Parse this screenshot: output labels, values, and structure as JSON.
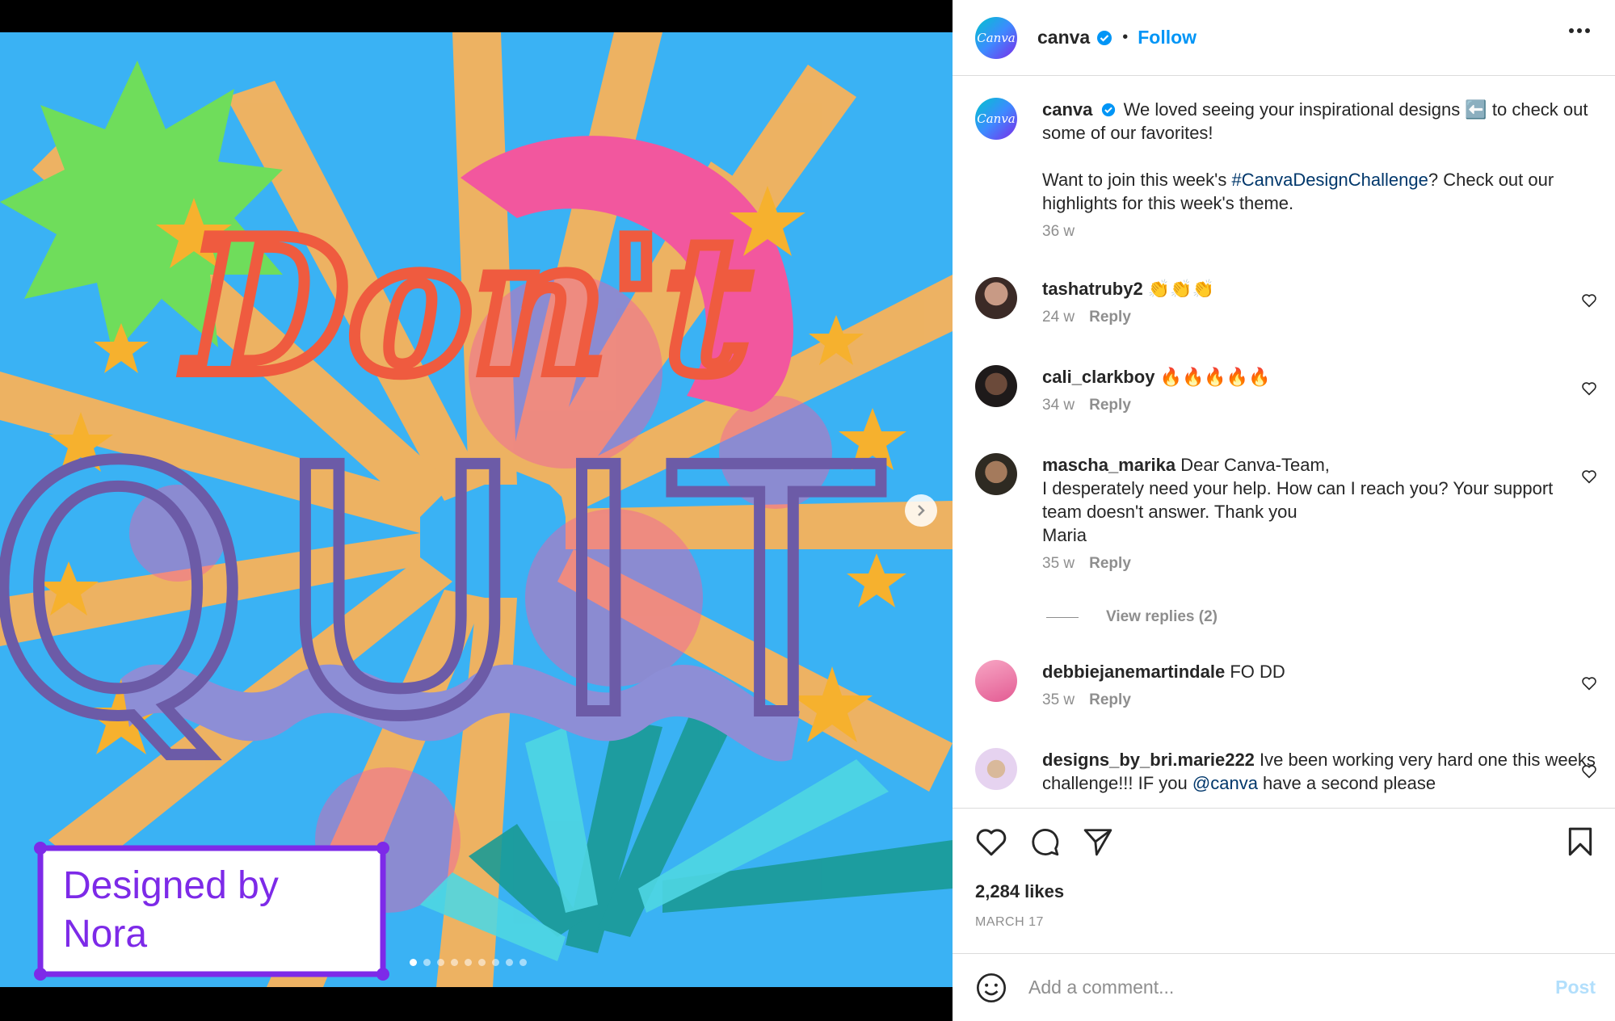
{
  "post": {
    "username": "canva",
    "follow_label": "Follow",
    "avatar_text": "Canva",
    "separator": "•",
    "verified_icon": "verified-badge-icon",
    "accent_color": "#0095f6"
  },
  "artwork": {
    "headline_top": "Don't",
    "headline_bottom": "QUIT",
    "credit_line1": "Designed by",
    "credit_line2": "Nora",
    "carousel_total": 9,
    "carousel_active": 1
  },
  "caption": {
    "text1": "We loved seeing your inspirational designs ⬅️ to check out some of our favorites!",
    "text2_pre": "Want to join this week's ",
    "hashtag": "#CanvaDesignChallenge",
    "text2_post": "? Check out our highlights for this week's theme.",
    "time": "36 w"
  },
  "comments": [
    {
      "username": "tashatruby2",
      "text": "👏👏👏",
      "time": "24 w",
      "reply_label": "Reply"
    },
    {
      "username": "cali_clarkboy",
      "text": "🔥🔥🔥🔥🔥",
      "time": "34 w",
      "reply_label": "Reply"
    },
    {
      "username": "mascha_marika",
      "text": "Dear Canva-Team,",
      "line2": "I desperately need your help. How can I reach you? Your support team doesn't answer. Thank you",
      "line3": "Maria",
      "time": "35 w",
      "reply_label": "Reply",
      "view_replies": "View replies (2)"
    },
    {
      "username": "debbiejanemartindale",
      "text": "FO DD",
      "time": "35 w",
      "reply_label": "Reply"
    },
    {
      "username": "designs_by_bri.marie222",
      "text_pre": "Ive been working very hard one this weeks challenge!!! IF you ",
      "mention": "@canva",
      "text_post": " have a second please"
    }
  ],
  "actions": {
    "likes": "2,284 likes",
    "date": "MARCH 17"
  },
  "composer": {
    "placeholder": "Add a comment...",
    "post_label": "Post"
  }
}
